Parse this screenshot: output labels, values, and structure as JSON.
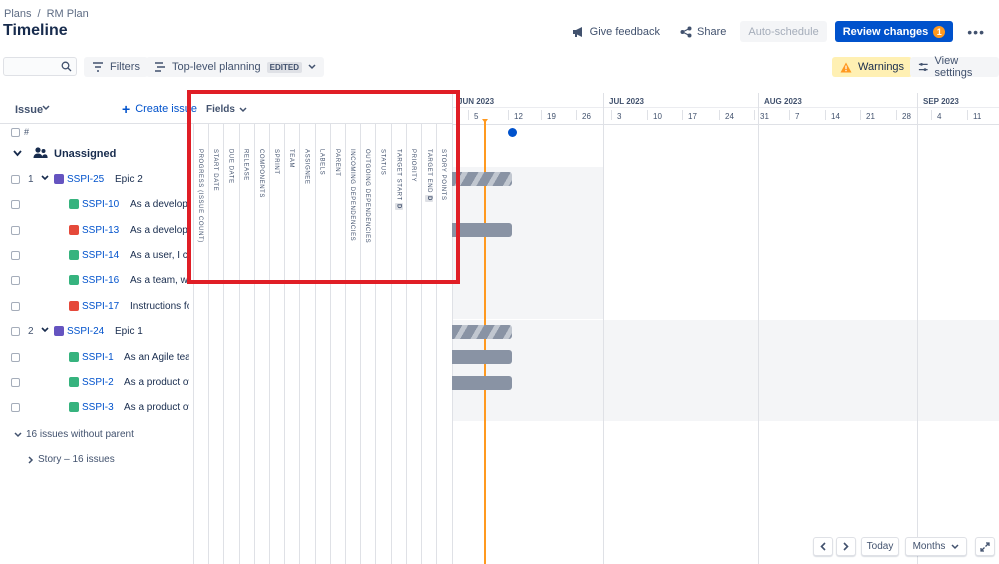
{
  "breadcrumb": {
    "root": "Plans",
    "sep": "/",
    "current": "RM Plan"
  },
  "page_title": "Timeline",
  "header_actions": {
    "feedback": "Give feedback",
    "share": "Share",
    "auto_schedule": "Auto-schedule",
    "review_changes": "Review changes",
    "review_count": "1"
  },
  "toolbar": {
    "filters": "Filters",
    "planning": "Top-level planning",
    "edited": "EDITED",
    "warnings": "Warnings",
    "view_settings": "View settings"
  },
  "issue_panel": {
    "column_label": "Issue",
    "create_issue": "Create issue",
    "hash": "#",
    "group_label": "Unassigned",
    "rows": [
      {
        "num": "1",
        "key": "SSPI-25",
        "summary": "Epic 2",
        "type": "epic"
      },
      {
        "num": "",
        "key": "SSPI-10",
        "summary": "As a developer...",
        "type": "story"
      },
      {
        "num": "",
        "key": "SSPI-13",
        "summary": "As a developer...",
        "type": "bug"
      },
      {
        "num": "",
        "key": "SSPI-14",
        "summary": "As a user, I can ...",
        "type": "story"
      },
      {
        "num": "",
        "key": "SSPI-16",
        "summary": "As a team, we c...",
        "type": "story"
      },
      {
        "num": "",
        "key": "SSPI-17",
        "summary": "Instructions for...",
        "type": "bug"
      },
      {
        "num": "2",
        "key": "SSPI-24",
        "summary": "Epic 1",
        "type": "epic"
      },
      {
        "num": "",
        "key": "SSPI-1",
        "summary": "As an Agile tea...",
        "type": "story"
      },
      {
        "num": "",
        "key": "SSPI-2",
        "summary": "As a product ow...",
        "type": "story"
      },
      {
        "num": "",
        "key": "SSPI-3",
        "summary": "As a product ow...",
        "type": "story"
      }
    ],
    "no_parent": "16 issues without parent",
    "story_group": "Story – 16 issues"
  },
  "fields": {
    "label": "Fields",
    "columns": [
      {
        "label": "PROGRESS (ISSUE COUNT)"
      },
      {
        "label": "START DATE"
      },
      {
        "label": "DUE DATE"
      },
      {
        "label": "RELEASE"
      },
      {
        "label": "COMPONENTS"
      },
      {
        "label": "SPRINT"
      },
      {
        "label": "TEAM"
      },
      {
        "label": "ASSIGNEE"
      },
      {
        "label": "LABELS"
      },
      {
        "label": "PARENT"
      },
      {
        "label": "INCOMING DEPENDENCIES"
      },
      {
        "label": "OUTGOING DEPENDENCIES"
      },
      {
        "label": "STATUS"
      },
      {
        "label": "TARGET START",
        "badge": "D"
      },
      {
        "label": "PRIORITY"
      },
      {
        "label": "TARGET END",
        "badge": "D"
      },
      {
        "label": "STORY POINTS"
      }
    ]
  },
  "timeline": {
    "months": [
      "JUN 2023",
      "JUL 2023",
      "AUG 2023",
      "SEP 2023"
    ],
    "days": [
      "5",
      "12",
      "19",
      "26",
      "3",
      "10",
      "17",
      "24",
      "31",
      "7",
      "14",
      "21",
      "28",
      "4",
      "11"
    ]
  },
  "bottom_controls": {
    "today": "Today",
    "scale": "Months"
  }
}
